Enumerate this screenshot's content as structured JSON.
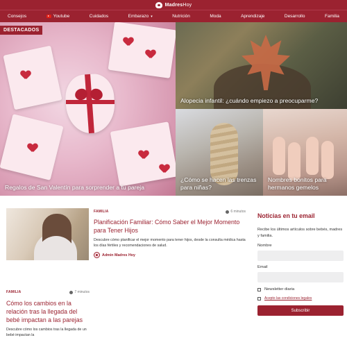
{
  "brand": {
    "name_bold": "Madres",
    "name_regular": "Hoy"
  },
  "nav": {
    "items": [
      {
        "label": "Consejos"
      },
      {
        "label": "Youtube"
      },
      {
        "label": "Cuidados"
      },
      {
        "label": "Embarazo",
        "caret": "▾"
      },
      {
        "label": "Nutrición"
      },
      {
        "label": "Moda"
      },
      {
        "label": "Aprendizaje"
      },
      {
        "label": "Desarrollo"
      },
      {
        "label": "Familia"
      }
    ]
  },
  "featured": {
    "badge": "DESTACADOS",
    "main": {
      "title": "Regalos de San Valentín para sorprender a tu pareja"
    },
    "top": {
      "title": "Alopecia infantil: ¿cuándo empiezo a preocuparme?"
    },
    "bottom_left": {
      "title": "¿Cómo se hacen las trenzas para niñas?"
    },
    "bottom_right": {
      "title": "Nombres bonitos para hermanos gemelos"
    }
  },
  "articles": [
    {
      "category": "FAMILIA",
      "read_time": "6 minutos",
      "title": "Planificación Familiar: Cómo Saber el Mejor Momento para Tener Hijos",
      "description": "Descubre cómo planificar el mejor momento para tener hijos, desde la consulta médica hasta los días fértiles y recomendaciones de salud.",
      "author": "Admin Madres Hoy"
    },
    {
      "category": "FAMILIA",
      "read_time": "7 minutos",
      "title": "Cómo los cambios en la relación tras la llegada del bebé impactan a las parejas",
      "description": "Descubre cómo los cambios tras la llegada de un bebé impactan la"
    }
  ],
  "newsletter": {
    "title": "Noticias en tu email",
    "text": "Recibe los últimos artículos sobre bebés, madres y familia.",
    "name_label": "Nombre",
    "email_label": "Email",
    "daily_label": "Newsletter diaria",
    "terms_label": "Acepto las condiciones legales",
    "subscribe_label": "Subscribir"
  },
  "colors": {
    "brand": "#9b2230",
    "input_bg": "#eeeeef"
  }
}
